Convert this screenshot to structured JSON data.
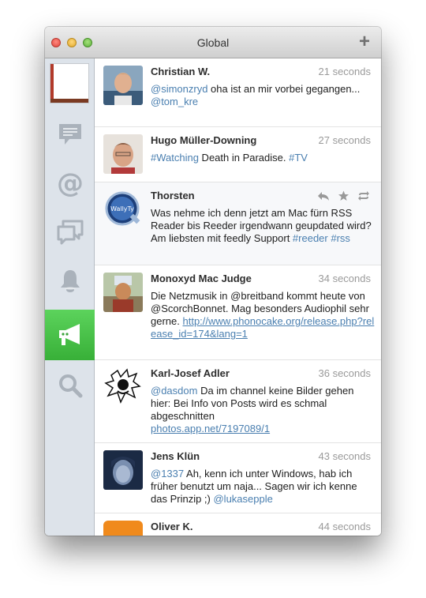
{
  "window": {
    "title": "Global",
    "add_label": "+"
  },
  "sidebar": {
    "items": [
      "timeline",
      "mentions",
      "messages",
      "notifications",
      "global",
      "search"
    ]
  },
  "tweets": [
    {
      "name": "Christian W.",
      "time": "21 seconds",
      "mention": "@simonzryd",
      "text": " oha ist an mir vorbei gegangen...",
      "mention2": "@tom_kre"
    },
    {
      "name": "Hugo Müller-Downing",
      "time": "27 seconds",
      "tag1": "#Watching",
      "text": " Death in Paradise. ",
      "tag2": "#TV"
    },
    {
      "name": "Thorsten",
      "text1": "Was nehme ich denn jetzt am Mac fürn RSS Reader bis Reeder irgendwann geupdated wird?",
      "text2": "Am liebsten mit feedly Support ",
      "tag1": "#reeder",
      "tag2": "#rss",
      "avatar_text": "WallyTy"
    },
    {
      "name": "Monoxyd Mac Judge",
      "time": "34 seconds",
      "text": "Die Netzmusik in @breitband kommt heute von @ScorchBonnet. Mag besonders Audiophil sehr gerne. ",
      "link": "http://www.phonocake.org/release.php?release_id=174&lang=1"
    },
    {
      "name": "Karl-Josef Adler",
      "time": "36 seconds",
      "mention": "@dasdom",
      "text": " Da im channel keine Bilder gehen hier: Bei Info von Posts wird es schmal abgeschnitten",
      "link": "photos.app.net/7197089/1"
    },
    {
      "name": "Jens Klün",
      "time": "43 seconds",
      "mention": "@1337",
      "text": " Ah, kenn ich unter Windows, hab ich früher benutzt um naja... Sagen wir ich kenne das Prinzip ;) ",
      "mention2": "@lukasepple"
    },
    {
      "name": "Oliver K.",
      "time": "44 seconds"
    }
  ]
}
